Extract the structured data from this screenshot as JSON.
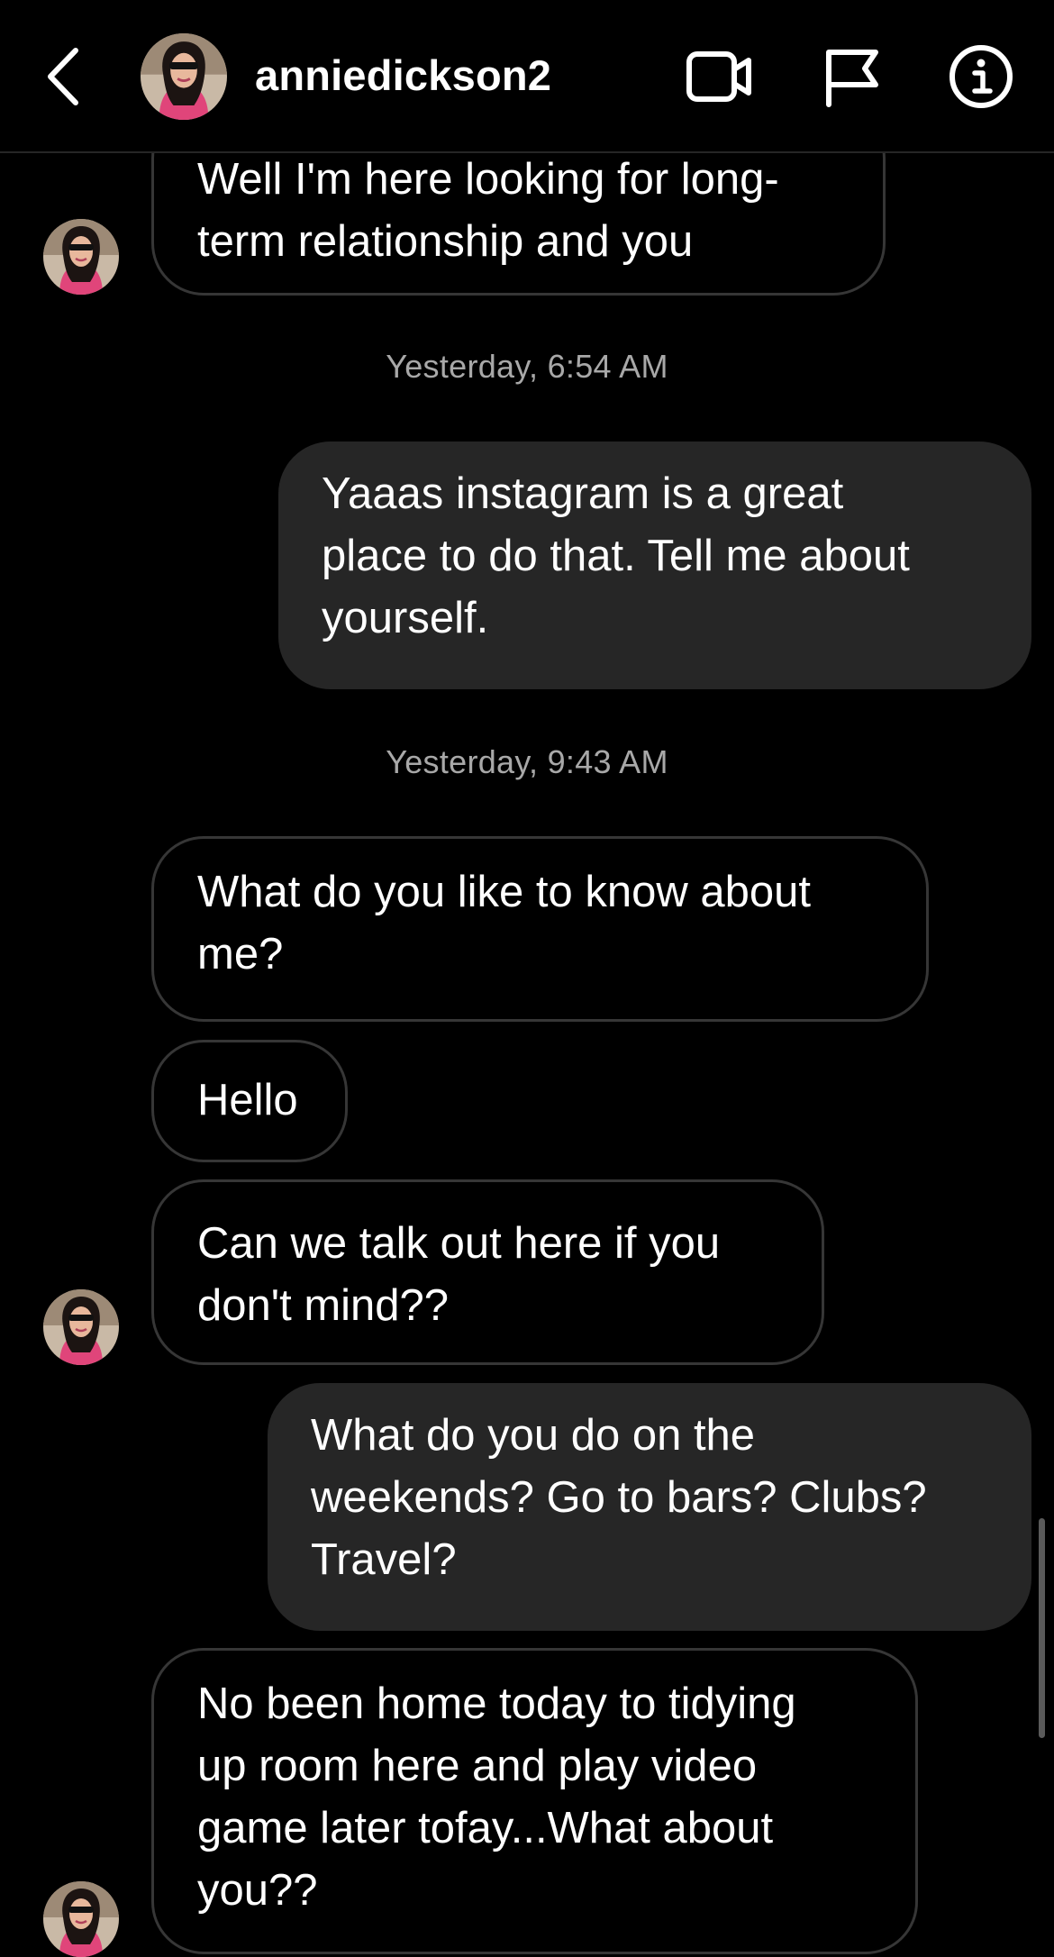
{
  "header": {
    "username": "anniedickson2",
    "back_icon": "chevron-left-icon",
    "video_icon": "video-camera-icon",
    "flag_icon": "flag-icon",
    "info_icon": "info-icon"
  },
  "messages": [
    {
      "sender": "them",
      "lines": [
        "Well I'm here looking for long-",
        "term relationship and you"
      ]
    },
    {
      "type": "timestamp",
      "text": "Yesterday, 6:54 AM"
    },
    {
      "sender": "me",
      "lines": [
        "Yaaas instagram is a great",
        "place to do that. Tell me about",
        "yourself."
      ]
    },
    {
      "type": "timestamp",
      "text": "Yesterday, 9:43 AM"
    },
    {
      "sender": "them",
      "lines": [
        "What do you like to know about",
        "me?"
      ]
    },
    {
      "sender": "them",
      "lines": [
        "Hello"
      ]
    },
    {
      "sender": "them",
      "lines": [
        "Can we talk out here if you",
        "don't mind??"
      ]
    },
    {
      "sender": "me",
      "lines": [
        "What do you do on the",
        "weekends? Go to bars? Clubs?",
        "Travel?"
      ]
    },
    {
      "sender": "them",
      "lines": [
        "No been home today to tidying",
        "up room here and play video",
        "game later tofay...What about",
        "you??"
      ]
    }
  ],
  "colors": {
    "background": "#000000",
    "sent_bubble": "#262626",
    "received_border": "#363636",
    "timestamp": "#a8a8a8"
  }
}
